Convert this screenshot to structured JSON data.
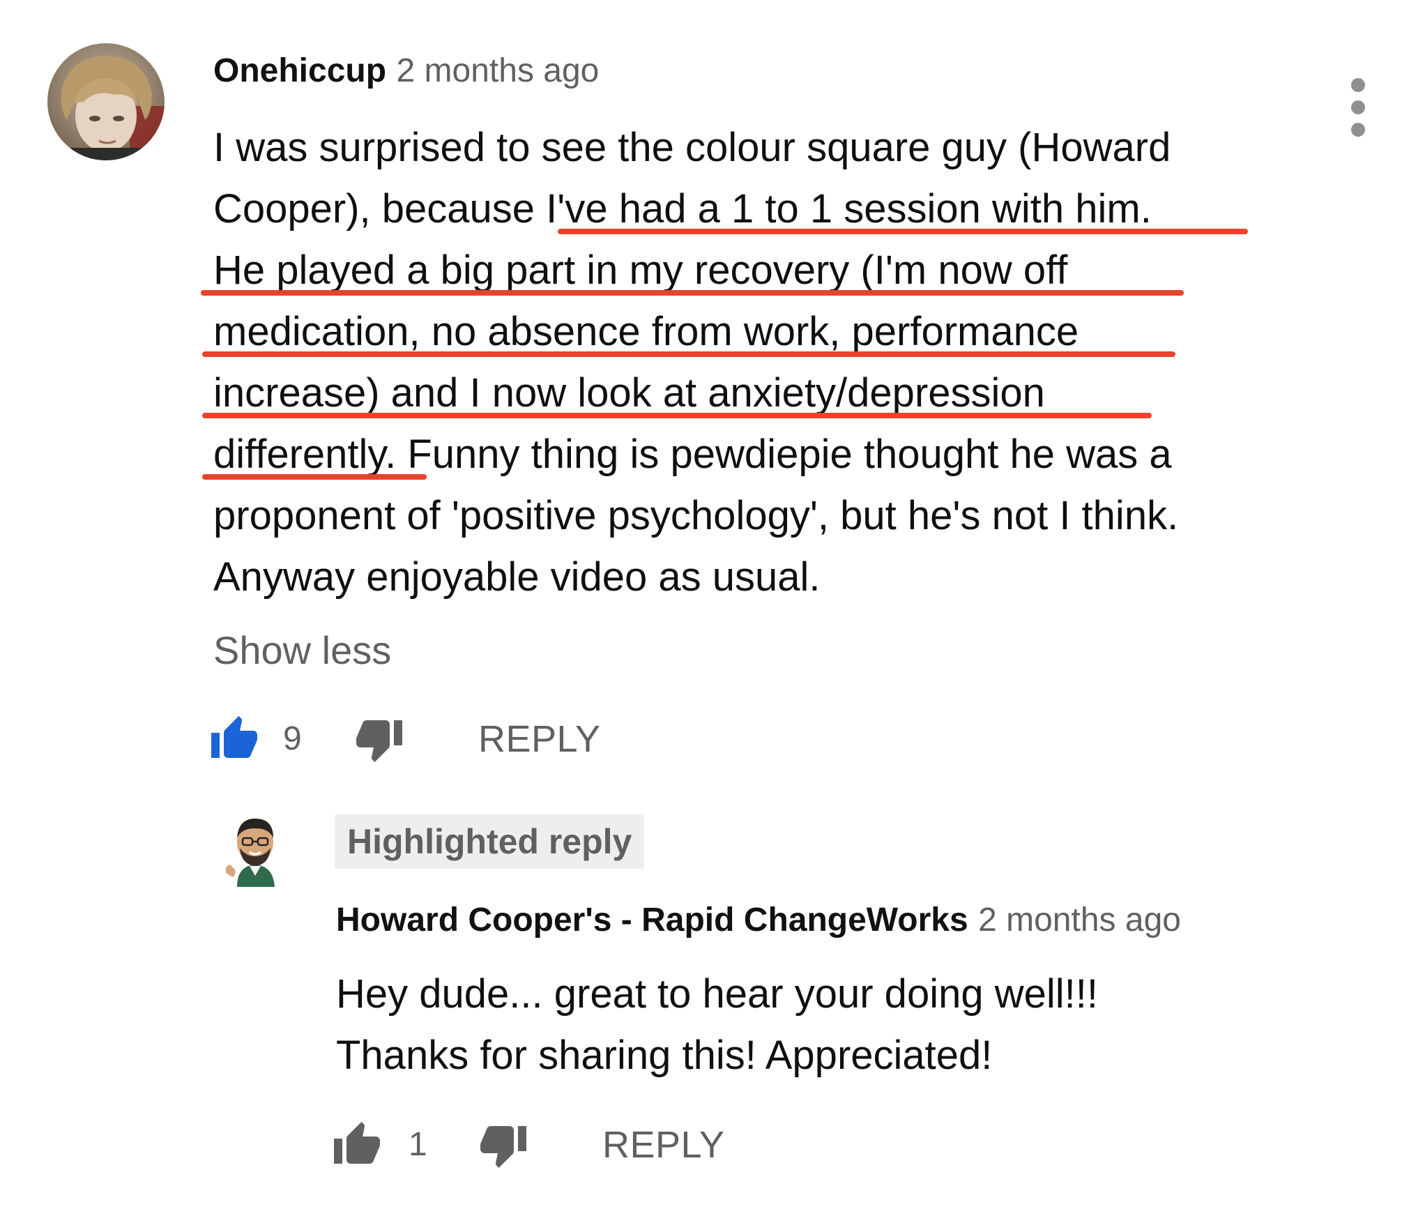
{
  "comment": {
    "author": "Onehiccup",
    "timestamp": "2 months ago",
    "text_lines": [
      "I was surprised to see the colour square guy (Howard",
      "Cooper), because I've had a 1 to 1 session with him.",
      "He played a big part in my recovery (I'm now off",
      "medication, no absence from work, performance",
      "increase) and I now look at anxiety/depression",
      "differently. Funny thing is pewdiepie thought he was a",
      "proponent of 'positive psychology', but he's not I think.",
      "Anyway enjoyable video as usual."
    ],
    "show_less_label": "Show less",
    "like_count": "9",
    "reply_label": "REPLY",
    "like_icon": "thumbs-up-filled-icon",
    "dislike_icon": "thumbs-down-icon",
    "menu_icon": "more-vertical-icon"
  },
  "reply": {
    "badge": "Highlighted reply",
    "author": "Howard Cooper's - Rapid ChangeWorks",
    "timestamp": "2 months ago",
    "text_lines": [
      "Hey dude... great to hear your doing well!!!",
      "Thanks for sharing this! Appreciated!"
    ],
    "like_count": "1",
    "reply_label": "REPLY",
    "like_icon": "thumbs-up-icon",
    "dislike_icon": "thumbs-down-icon"
  },
  "colors": {
    "like_active": "#1a64d6",
    "icon_gray": "#606060",
    "underline_annotation": "#e8442b",
    "badge_bg": "#eeeeee"
  }
}
